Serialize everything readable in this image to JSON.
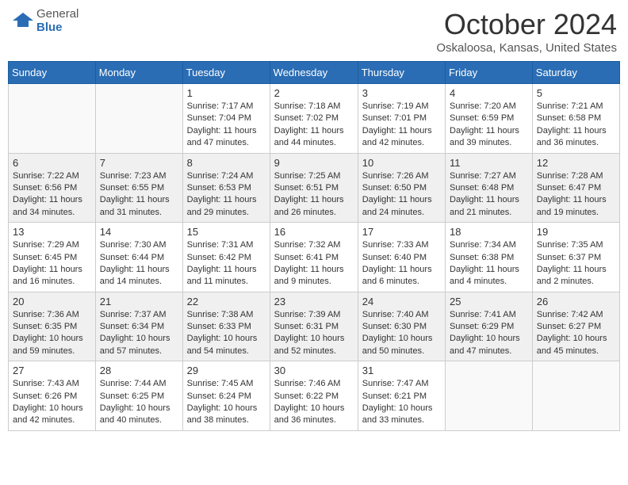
{
  "header": {
    "logo_general": "General",
    "logo_blue": "Blue",
    "month": "October 2024",
    "location": "Oskaloosa, Kansas, United States"
  },
  "weekdays": [
    "Sunday",
    "Monday",
    "Tuesday",
    "Wednesday",
    "Thursday",
    "Friday",
    "Saturday"
  ],
  "weeks": [
    [
      {
        "day": "",
        "sunrise": "",
        "sunset": "",
        "daylight": ""
      },
      {
        "day": "",
        "sunrise": "",
        "sunset": "",
        "daylight": ""
      },
      {
        "day": "1",
        "sunrise": "Sunrise: 7:17 AM",
        "sunset": "Sunset: 7:04 PM",
        "daylight": "Daylight: 11 hours and 47 minutes."
      },
      {
        "day": "2",
        "sunrise": "Sunrise: 7:18 AM",
        "sunset": "Sunset: 7:02 PM",
        "daylight": "Daylight: 11 hours and 44 minutes."
      },
      {
        "day": "3",
        "sunrise": "Sunrise: 7:19 AM",
        "sunset": "Sunset: 7:01 PM",
        "daylight": "Daylight: 11 hours and 42 minutes."
      },
      {
        "day": "4",
        "sunrise": "Sunrise: 7:20 AM",
        "sunset": "Sunset: 6:59 PM",
        "daylight": "Daylight: 11 hours and 39 minutes."
      },
      {
        "day": "5",
        "sunrise": "Sunrise: 7:21 AM",
        "sunset": "Sunset: 6:58 PM",
        "daylight": "Daylight: 11 hours and 36 minutes."
      }
    ],
    [
      {
        "day": "6",
        "sunrise": "Sunrise: 7:22 AM",
        "sunset": "Sunset: 6:56 PM",
        "daylight": "Daylight: 11 hours and 34 minutes."
      },
      {
        "day": "7",
        "sunrise": "Sunrise: 7:23 AM",
        "sunset": "Sunset: 6:55 PM",
        "daylight": "Daylight: 11 hours and 31 minutes."
      },
      {
        "day": "8",
        "sunrise": "Sunrise: 7:24 AM",
        "sunset": "Sunset: 6:53 PM",
        "daylight": "Daylight: 11 hours and 29 minutes."
      },
      {
        "day": "9",
        "sunrise": "Sunrise: 7:25 AM",
        "sunset": "Sunset: 6:51 PM",
        "daylight": "Daylight: 11 hours and 26 minutes."
      },
      {
        "day": "10",
        "sunrise": "Sunrise: 7:26 AM",
        "sunset": "Sunset: 6:50 PM",
        "daylight": "Daylight: 11 hours and 24 minutes."
      },
      {
        "day": "11",
        "sunrise": "Sunrise: 7:27 AM",
        "sunset": "Sunset: 6:48 PM",
        "daylight": "Daylight: 11 hours and 21 minutes."
      },
      {
        "day": "12",
        "sunrise": "Sunrise: 7:28 AM",
        "sunset": "Sunset: 6:47 PM",
        "daylight": "Daylight: 11 hours and 19 minutes."
      }
    ],
    [
      {
        "day": "13",
        "sunrise": "Sunrise: 7:29 AM",
        "sunset": "Sunset: 6:45 PM",
        "daylight": "Daylight: 11 hours and 16 minutes."
      },
      {
        "day": "14",
        "sunrise": "Sunrise: 7:30 AM",
        "sunset": "Sunset: 6:44 PM",
        "daylight": "Daylight: 11 hours and 14 minutes."
      },
      {
        "day": "15",
        "sunrise": "Sunrise: 7:31 AM",
        "sunset": "Sunset: 6:42 PM",
        "daylight": "Daylight: 11 hours and 11 minutes."
      },
      {
        "day": "16",
        "sunrise": "Sunrise: 7:32 AM",
        "sunset": "Sunset: 6:41 PM",
        "daylight": "Daylight: 11 hours and 9 minutes."
      },
      {
        "day": "17",
        "sunrise": "Sunrise: 7:33 AM",
        "sunset": "Sunset: 6:40 PM",
        "daylight": "Daylight: 11 hours and 6 minutes."
      },
      {
        "day": "18",
        "sunrise": "Sunrise: 7:34 AM",
        "sunset": "Sunset: 6:38 PM",
        "daylight": "Daylight: 11 hours and 4 minutes."
      },
      {
        "day": "19",
        "sunrise": "Sunrise: 7:35 AM",
        "sunset": "Sunset: 6:37 PM",
        "daylight": "Daylight: 11 hours and 2 minutes."
      }
    ],
    [
      {
        "day": "20",
        "sunrise": "Sunrise: 7:36 AM",
        "sunset": "Sunset: 6:35 PM",
        "daylight": "Daylight: 10 hours and 59 minutes."
      },
      {
        "day": "21",
        "sunrise": "Sunrise: 7:37 AM",
        "sunset": "Sunset: 6:34 PM",
        "daylight": "Daylight: 10 hours and 57 minutes."
      },
      {
        "day": "22",
        "sunrise": "Sunrise: 7:38 AM",
        "sunset": "Sunset: 6:33 PM",
        "daylight": "Daylight: 10 hours and 54 minutes."
      },
      {
        "day": "23",
        "sunrise": "Sunrise: 7:39 AM",
        "sunset": "Sunset: 6:31 PM",
        "daylight": "Daylight: 10 hours and 52 minutes."
      },
      {
        "day": "24",
        "sunrise": "Sunrise: 7:40 AM",
        "sunset": "Sunset: 6:30 PM",
        "daylight": "Daylight: 10 hours and 50 minutes."
      },
      {
        "day": "25",
        "sunrise": "Sunrise: 7:41 AM",
        "sunset": "Sunset: 6:29 PM",
        "daylight": "Daylight: 10 hours and 47 minutes."
      },
      {
        "day": "26",
        "sunrise": "Sunrise: 7:42 AM",
        "sunset": "Sunset: 6:27 PM",
        "daylight": "Daylight: 10 hours and 45 minutes."
      }
    ],
    [
      {
        "day": "27",
        "sunrise": "Sunrise: 7:43 AM",
        "sunset": "Sunset: 6:26 PM",
        "daylight": "Daylight: 10 hours and 42 minutes."
      },
      {
        "day": "28",
        "sunrise": "Sunrise: 7:44 AM",
        "sunset": "Sunset: 6:25 PM",
        "daylight": "Daylight: 10 hours and 40 minutes."
      },
      {
        "day": "29",
        "sunrise": "Sunrise: 7:45 AM",
        "sunset": "Sunset: 6:24 PM",
        "daylight": "Daylight: 10 hours and 38 minutes."
      },
      {
        "day": "30",
        "sunrise": "Sunrise: 7:46 AM",
        "sunset": "Sunset: 6:22 PM",
        "daylight": "Daylight: 10 hours and 36 minutes."
      },
      {
        "day": "31",
        "sunrise": "Sunrise: 7:47 AM",
        "sunset": "Sunset: 6:21 PM",
        "daylight": "Daylight: 10 hours and 33 minutes."
      },
      {
        "day": "",
        "sunrise": "",
        "sunset": "",
        "daylight": ""
      },
      {
        "day": "",
        "sunrise": "",
        "sunset": "",
        "daylight": ""
      }
    ]
  ]
}
